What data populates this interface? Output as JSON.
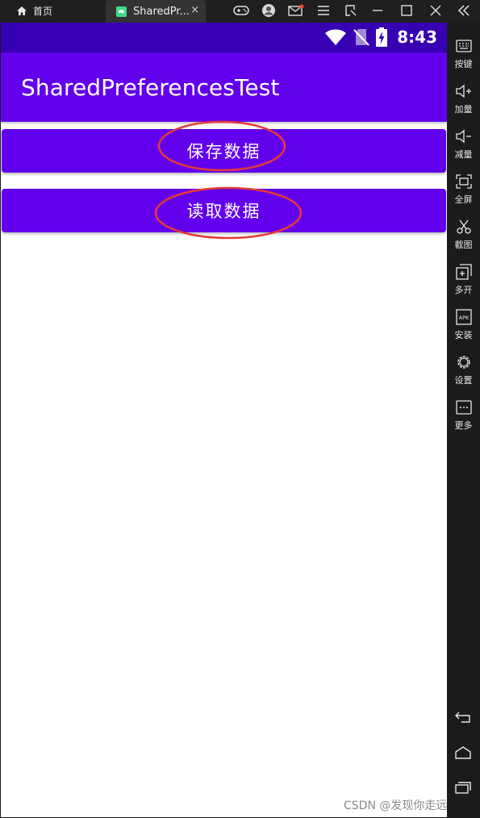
{
  "window": {
    "home_tab_label": "首页",
    "app_tab_label": "SharedPr...",
    "tab_close": "×"
  },
  "status_bar": {
    "time": "8:43"
  },
  "app": {
    "title": "SharedPreferencesTest",
    "save_button_label": "保存数据",
    "read_button_label": "读取数据",
    "primary_color": "#6200ee",
    "primary_dark_color": "#3700b3",
    "annotation_color": "#e53935"
  },
  "sidebar": {
    "items": [
      {
        "label": "按键",
        "icon": "keyboard-icon"
      },
      {
        "label": "加量",
        "icon": "volume-up-icon"
      },
      {
        "label": "减量",
        "icon": "volume-down-icon"
      },
      {
        "label": "全屏",
        "icon": "fullscreen-icon"
      },
      {
        "label": "截图",
        "icon": "scissors-icon"
      },
      {
        "label": "多开",
        "icon": "multi-instance-icon"
      },
      {
        "label": "安装",
        "icon": "apk-install-icon"
      },
      {
        "label": "设置",
        "icon": "gear-icon"
      },
      {
        "label": "更多",
        "icon": "more-icon"
      }
    ],
    "apk_icon_text": "APK"
  },
  "watermark": "CSDN @发现你走远了"
}
